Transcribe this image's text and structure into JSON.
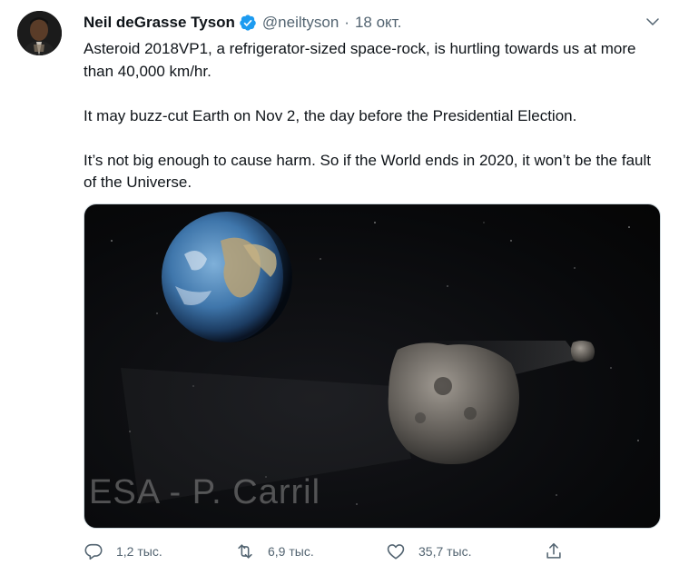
{
  "author": {
    "name": "Neil deGrasse Tyson",
    "handle": "@neiltyson",
    "separator": "·",
    "date": "18 окт.",
    "verified": true
  },
  "tweet": {
    "paragraphs": [
      "Asteroid 2018VP1, a refrigerator-sized space-rock, is hurtling towards us at more than 40,000 km/hr.",
      "It may buzz-cut Earth on Nov 2, the day before the Presidential Election.",
      "It’s not big enough to cause harm. So if the World ends in 2020, it won’t be the fault of the Universe."
    ]
  },
  "media": {
    "watermark": "ESA - P. Carril"
  },
  "actions": {
    "replies": "1,2 тыс.",
    "retweets": "6,9 тыс.",
    "likes": "35,7 тыс."
  },
  "icons": {
    "verified": "verified-badge-icon",
    "more": "chevron-down-icon",
    "reply": "reply-icon",
    "retweet": "retweet-icon",
    "like": "heart-icon",
    "share": "share-icon"
  },
  "colors": {
    "accent": "#1d9bf0",
    "secondary_text": "#536471"
  }
}
